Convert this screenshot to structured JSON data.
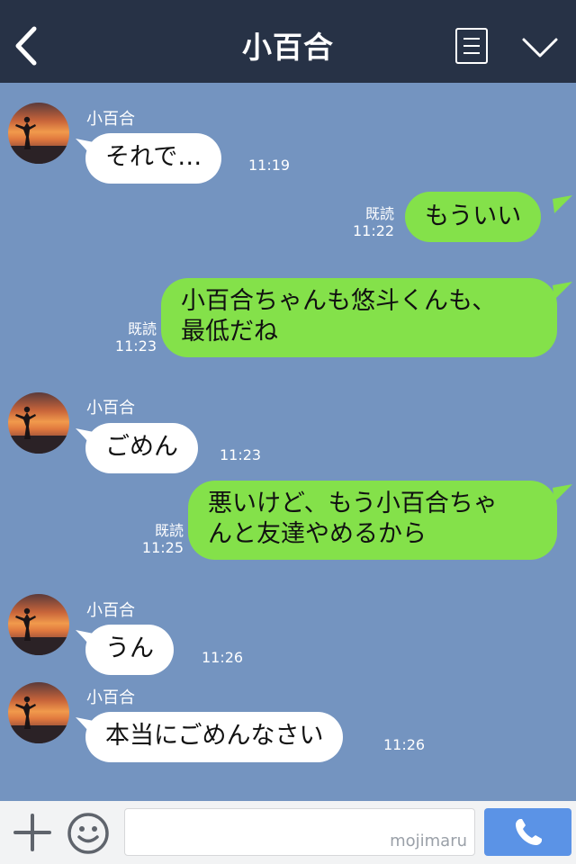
{
  "header": {
    "title": "小百合"
  },
  "messages": {
    "m1": {
      "sender": "小百合",
      "text": "それで…",
      "time": "11:19"
    },
    "m2": {
      "text": "もういい",
      "read": "既読",
      "time": "11:22"
    },
    "m3": {
      "line1": "小百合ちゃんも悠斗くんも、",
      "line2": "最低だね",
      "read": "既読",
      "time": "11:23"
    },
    "m4": {
      "sender": "小百合",
      "text": "ごめん",
      "time": "11:23"
    },
    "m5": {
      "line1": "悪いけど、もう小百合ちゃ",
      "line2": "んと友達やめるから",
      "read": "既読",
      "time": "11:25"
    },
    "m6": {
      "sender": "小百合",
      "text": "うん",
      "time": "11:26"
    },
    "m7": {
      "sender": "小百合",
      "text": "本当にごめんなさい",
      "time": "11:26"
    }
  },
  "footer": {
    "input_value": "",
    "watermark": "mojimaru"
  },
  "colors": {
    "header_bg": "#273246",
    "chat_bg": "#7494c0",
    "outgoing_bubble": "#84e14a",
    "incoming_bubble": "#ffffff",
    "call_button": "#5b93e6"
  },
  "icons": [
    "back-chevron-icon",
    "menu-list-icon",
    "chevron-down-icon",
    "plus-icon",
    "emoji-icon",
    "phone-icon"
  ]
}
